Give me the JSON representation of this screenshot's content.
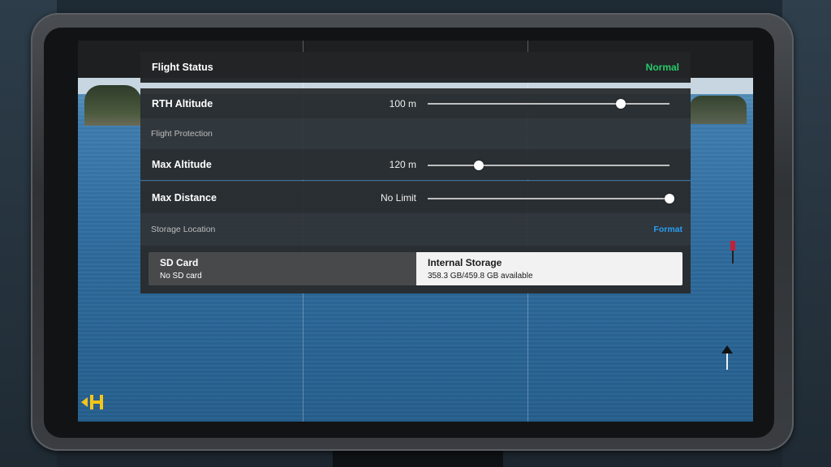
{
  "flight_status": {
    "label": "Flight Status",
    "value": "Normal",
    "value_color": "#27c96a"
  },
  "rth_altitude": {
    "label": "RTH Altitude",
    "value": "100 m",
    "slider_fraction": 0.8
  },
  "flight_protection": {
    "title": "Flight Protection",
    "max_altitude": {
      "label": "Max Altitude",
      "value": "120 m",
      "slider_fraction": 0.21
    },
    "max_distance": {
      "label": "Max Distance",
      "value": "No Limit",
      "slider_fraction": 1.0
    }
  },
  "storage": {
    "title": "Storage Location",
    "format_label": "Format",
    "options": [
      {
        "name": "SD Card",
        "detail": "No SD card",
        "selected": false
      },
      {
        "name": "Internal Storage",
        "detail": "358.3 GB/459.8 GB available",
        "selected": true
      }
    ]
  },
  "icons": {
    "home": "home-point-icon",
    "marker": "map-marker-icon",
    "arrow": "navigation-arrow-icon"
  },
  "colors": {
    "accent": "#2a9df4",
    "status_ok": "#27c96a"
  }
}
